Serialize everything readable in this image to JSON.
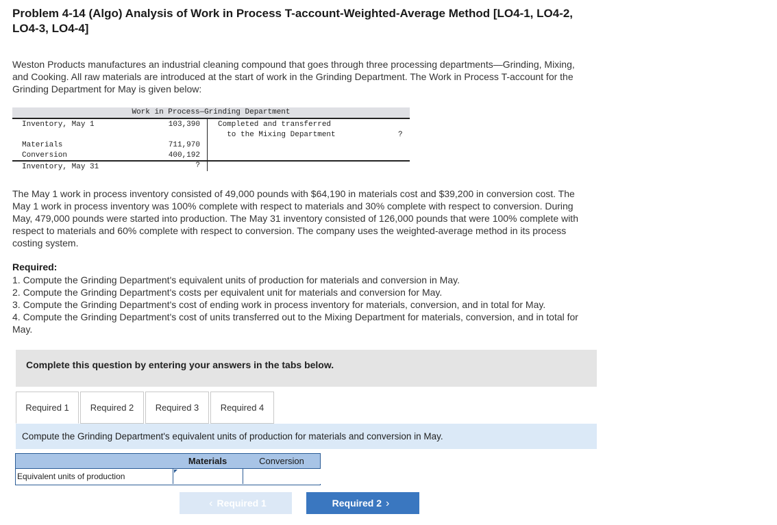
{
  "title": "Problem 4-14 (Algo) Analysis of Work in Process T-account-Weighted-Average Method [LO4-1, LO4-2,\nLO4-3, LO4-4]",
  "intro": "Weston Products manufactures an industrial cleaning compound that goes through three processing departments—Grinding, Mixing,\nand Cooking. All raw materials are introduced at the start of work in the Grinding Department. The Work in Process T-account for the\nGrinding Department for May is given below:",
  "t_account": {
    "title": "Work in Process—Grinding Department",
    "debits": [
      {
        "label": "Inventory, May 1",
        "value": "103,390"
      },
      {
        "label": "Materials",
        "value": "711,970"
      },
      {
        "label": "Conversion",
        "value": "400,192"
      },
      {
        "label": "Inventory, May 31",
        "value": "?"
      }
    ],
    "credit": {
      "label_line1": "Completed and transferred",
      "label_line2": "  to the Mixing Department",
      "value": "?"
    }
  },
  "details": "The May 1 work in process inventory consisted of 49,000 pounds with $64,190 in materials cost and $39,200 in conversion cost. The\nMay 1 work in process inventory was 100% complete with respect to materials and 30% complete with respect to conversion. During\nMay, 479,000 pounds were started into production. The May 31 inventory consisted of 126,000 pounds that were 100% complete with\nrespect to materials and 60% complete with respect to conversion. The company uses the weighted-average method in its process\ncosting system.",
  "required": {
    "heading": "Required:",
    "items": [
      "1. Compute the Grinding Department's equivalent units of production for materials and conversion in May.",
      "2. Compute the Grinding Department's costs per equivalent unit for materials and conversion for May.",
      "3. Compute the Grinding Department's cost of ending work in process inventory for materials, conversion, and in total for May.",
      "4. Compute the Grinding Department's cost of units transferred out to the Mixing Department for materials, conversion, and in total for\nMay."
    ]
  },
  "banner": "Complete this question by entering your answers in the tabs below.",
  "tabs": [
    {
      "label": "Required 1"
    },
    {
      "label": "Required 2"
    },
    {
      "label": "Required 3"
    },
    {
      "label": "Required 4"
    }
  ],
  "instruction": "Compute the Grinding Department's equivalent units of production for materials and conversion in May.",
  "answer_table": {
    "columns": [
      "Materials",
      "Conversion"
    ],
    "row_label": "Equivalent units of production",
    "materials_value": "",
    "conversion_value": ""
  },
  "nav": {
    "prev": "Required 1",
    "next": "Required 2",
    "prev_chevron": "‹",
    "next_chevron": "›"
  },
  "colors": {
    "header_blue": "#a8c4e6",
    "instruction_bg": "#dbe9f7",
    "next_button": "#3a77c0",
    "prev_button_disabled": "#dce8f6",
    "banner_bg": "#e4e4e4"
  }
}
